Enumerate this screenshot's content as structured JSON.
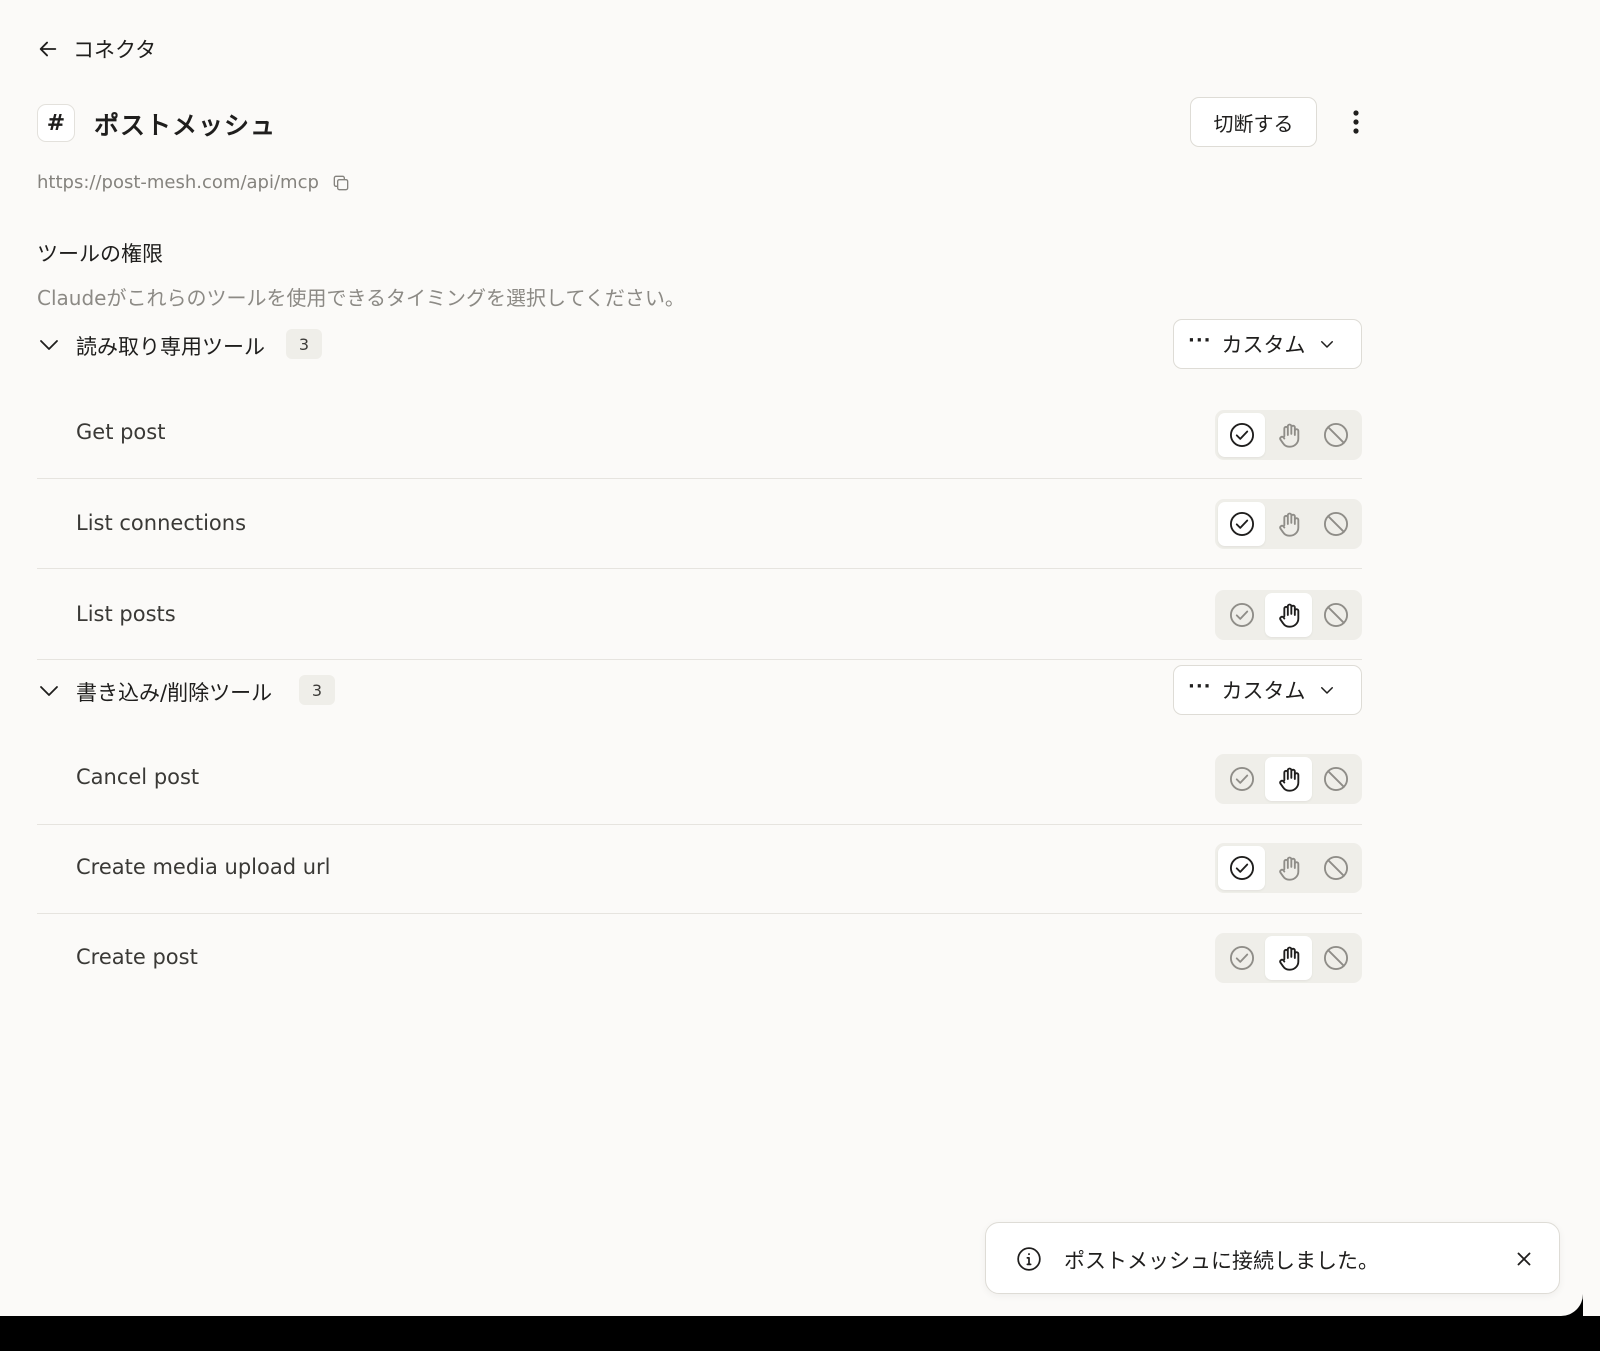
{
  "nav": {
    "back_label": "コネクタ"
  },
  "header": {
    "app_icon_glyph": "#",
    "title": "ポストメッシュ",
    "disconnect_label": "切断する"
  },
  "url": "https://post-mesh.com/api/mcp",
  "permissions": {
    "title": "ツールの権限",
    "description": "Claudeがこれらのツールを使用できるタイミングを選択してください。"
  },
  "groups": [
    {
      "label": "読み取り専用ツール",
      "count": "3",
      "mode_label": "カスタム",
      "tools": [
        {
          "name": "Get post",
          "selected": "allow"
        },
        {
          "name": "List connections",
          "selected": "allow"
        },
        {
          "name": "List posts",
          "selected": "ask"
        }
      ]
    },
    {
      "label": "書き込み/削除ツール",
      "count": "3",
      "mode_label": "カスタム",
      "tools": [
        {
          "name": "Cancel post",
          "selected": "ask"
        },
        {
          "name": "Create media upload url",
          "selected": "allow"
        },
        {
          "name": "Create post",
          "selected": "ask"
        }
      ]
    }
  ],
  "toast": {
    "message": "ポストメッシュに接続しました。"
  },
  "colors": {
    "background": "#fbfaf8",
    "border": "#dedcd6",
    "muted_text": "#8c8a85",
    "segment_bg": "#efeee9"
  }
}
